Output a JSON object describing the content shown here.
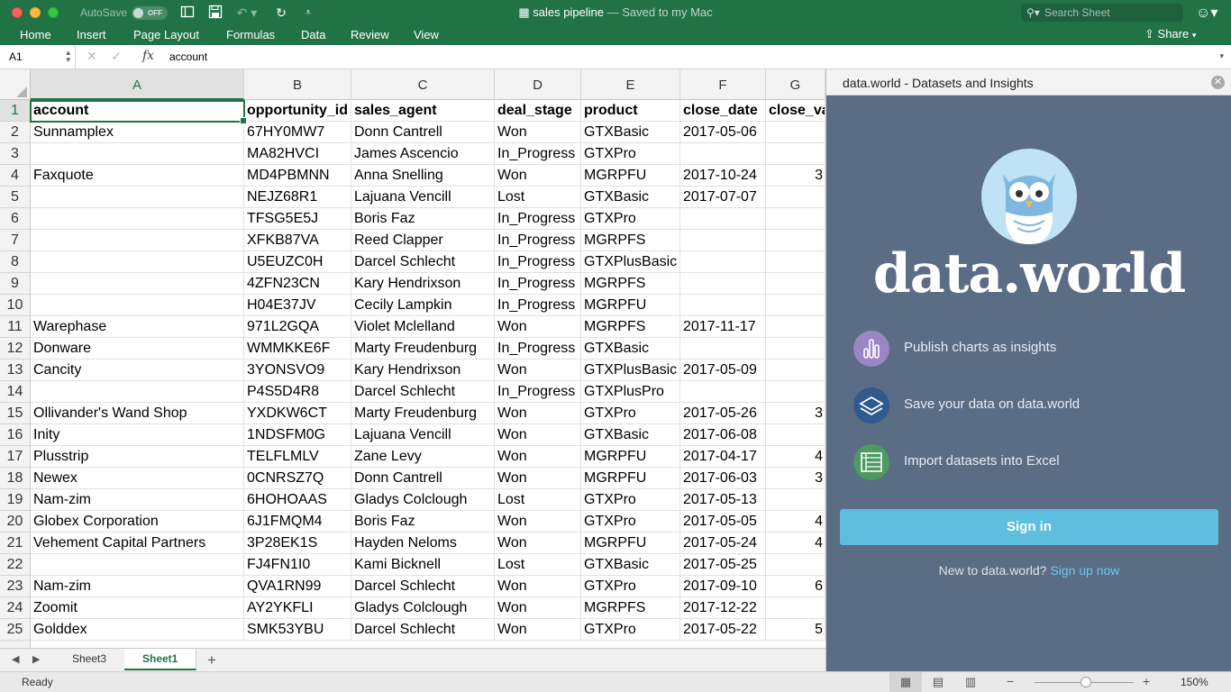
{
  "titlebar": {
    "autosave_label": "AutoSave",
    "autosave_state": "OFF",
    "doc_name": "sales pipeline",
    "saved_status": " — Saved to my Mac",
    "search_placeholder": "Search Sheet"
  },
  "ribbon": {
    "tabs": [
      "Home",
      "Insert",
      "Page Layout",
      "Formulas",
      "Data",
      "Review",
      "View"
    ],
    "share_label": "Share"
  },
  "formula_bar": {
    "name_box": "A1",
    "fx": "fx",
    "value": "account"
  },
  "grid": {
    "columns": [
      "A",
      "B",
      "C",
      "D",
      "E",
      "F",
      "G"
    ],
    "selected_column": "A",
    "rows": [
      {
        "n": "1",
        "cells": [
          "account",
          "opportunity_id",
          "sales_agent",
          "deal_stage",
          "product",
          "close_date",
          "close_va"
        ]
      },
      {
        "n": "2",
        "cells": [
          "Sunnamplex",
          "67HY0MW7",
          "Donn Cantrell",
          "Won",
          "GTXBasic",
          "2017-05-06",
          ""
        ]
      },
      {
        "n": "3",
        "cells": [
          "",
          "MA82HVCI",
          "James Ascencio",
          "In_Progress",
          "GTXPro",
          "",
          ""
        ]
      },
      {
        "n": "4",
        "cells": [
          "Faxquote",
          "MD4PBMNN",
          "Anna Snelling",
          "Won",
          "MGRPFU",
          "2017-10-24",
          "3"
        ]
      },
      {
        "n": "5",
        "cells": [
          "",
          "NEJZ68R1",
          "Lajuana Vencill",
          "Lost",
          "GTXBasic",
          "2017-07-07",
          ""
        ]
      },
      {
        "n": "6",
        "cells": [
          "",
          "TFSG5E5J",
          "Boris Faz",
          "In_Progress",
          "GTXPro",
          "",
          ""
        ]
      },
      {
        "n": "7",
        "cells": [
          "",
          "XFKB87VA",
          "Reed Clapper",
          "In_Progress",
          "MGRPFS",
          "",
          ""
        ]
      },
      {
        "n": "8",
        "cells": [
          "",
          "U5EUZC0H",
          "Darcel Schlecht",
          "In_Progress",
          "GTXPlusBasic",
          "",
          ""
        ]
      },
      {
        "n": "9",
        "cells": [
          "",
          "4ZFN23CN",
          "Kary Hendrixson",
          "In_Progress",
          "MGRPFS",
          "",
          ""
        ]
      },
      {
        "n": "10",
        "cells": [
          "",
          "H04E37JV",
          "Cecily Lampkin",
          "In_Progress",
          "MGRPFU",
          "",
          ""
        ]
      },
      {
        "n": "11",
        "cells": [
          "Warephase",
          "971L2GQA",
          "Violet Mclelland",
          "Won",
          "MGRPFS",
          "2017-11-17",
          ""
        ]
      },
      {
        "n": "12",
        "cells": [
          "Donware",
          "WMMKKE6F",
          "Marty Freudenburg",
          "In_Progress",
          "GTXBasic",
          "",
          ""
        ]
      },
      {
        "n": "13",
        "cells": [
          "Cancity",
          "3YONSVO9",
          "Kary Hendrixson",
          "Won",
          "GTXPlusBasic",
          "2017-05-09",
          ""
        ]
      },
      {
        "n": "14",
        "cells": [
          "",
          "P4S5D4R8",
          "Darcel Schlecht",
          "In_Progress",
          "GTXPlusPro",
          "",
          ""
        ]
      },
      {
        "n": "15",
        "cells": [
          "Ollivander's Wand Shop",
          "YXDKW6CT",
          "Marty Freudenburg",
          "Won",
          "GTXPro",
          "2017-05-26",
          "3"
        ]
      },
      {
        "n": "16",
        "cells": [
          "Inity",
          "1NDSFM0G",
          "Lajuana Vencill",
          "Won",
          "GTXBasic",
          "2017-06-08",
          ""
        ]
      },
      {
        "n": "17",
        "cells": [
          "Plusstrip",
          "TELFLMLV",
          "Zane Levy",
          "Won",
          "MGRPFU",
          "2017-04-17",
          "4"
        ]
      },
      {
        "n": "18",
        "cells": [
          "Newex",
          "0CNRSZ7Q",
          "Donn Cantrell",
          "Won",
          "MGRPFU",
          "2017-06-03",
          "3"
        ]
      },
      {
        "n": "19",
        "cells": [
          "Nam-zim",
          "6HOHOAAS",
          "Gladys Colclough",
          "Lost",
          "GTXPro",
          "2017-05-13",
          ""
        ]
      },
      {
        "n": "20",
        "cells": [
          "Globex Corporation",
          "6J1FMQM4",
          "Boris Faz",
          "Won",
          "GTXPro",
          "2017-05-05",
          "4"
        ]
      },
      {
        "n": "21",
        "cells": [
          "Vehement Capital Partners",
          "3P28EK1S",
          "Hayden Neloms",
          "Won",
          "MGRPFU",
          "2017-05-24",
          "4"
        ]
      },
      {
        "n": "22",
        "cells": [
          "",
          "FJ4FN1I0",
          "Kami Bicknell",
          "Lost",
          "GTXBasic",
          "2017-05-25",
          ""
        ]
      },
      {
        "n": "23",
        "cells": [
          "Nam-zim",
          "QVA1RN99",
          "Darcel Schlecht",
          "Won",
          "GTXPro",
          "2017-09-10",
          "6"
        ]
      },
      {
        "n": "24",
        "cells": [
          "Zoomit",
          "AY2YKFLI",
          "Gladys Colclough",
          "Won",
          "MGRPFS",
          "2017-12-22",
          ""
        ]
      },
      {
        "n": "25",
        "cells": [
          "Golddex",
          "SMK53YBU",
          "Darcel Schlecht",
          "Won",
          "GTXPro",
          "2017-05-22",
          "5"
        ]
      }
    ]
  },
  "sheets": {
    "tabs": [
      "Sheet3",
      "Sheet1"
    ],
    "active": "Sheet1"
  },
  "status": {
    "ready": "Ready",
    "zoom": "150%"
  },
  "addin": {
    "title": "data.world - Datasets and Insights",
    "brand": "data.world",
    "features": [
      {
        "icon": "bar-chart-icon",
        "label": "Publish charts as insights",
        "color": "#9b86c4"
      },
      {
        "icon": "layers-icon",
        "label": "Save your data on data.world",
        "color": "#2e5a8c"
      },
      {
        "icon": "table-import-icon",
        "label": "Import datasets into Excel",
        "color": "#4c9a62"
      }
    ],
    "signin_label": "Sign in",
    "new_to_text": "New to data.world?",
    "signup_link": "Sign up now"
  },
  "colors": {
    "excel_green": "#217346",
    "pane_background": "#5b6c85",
    "signin_button": "#5fbede"
  }
}
